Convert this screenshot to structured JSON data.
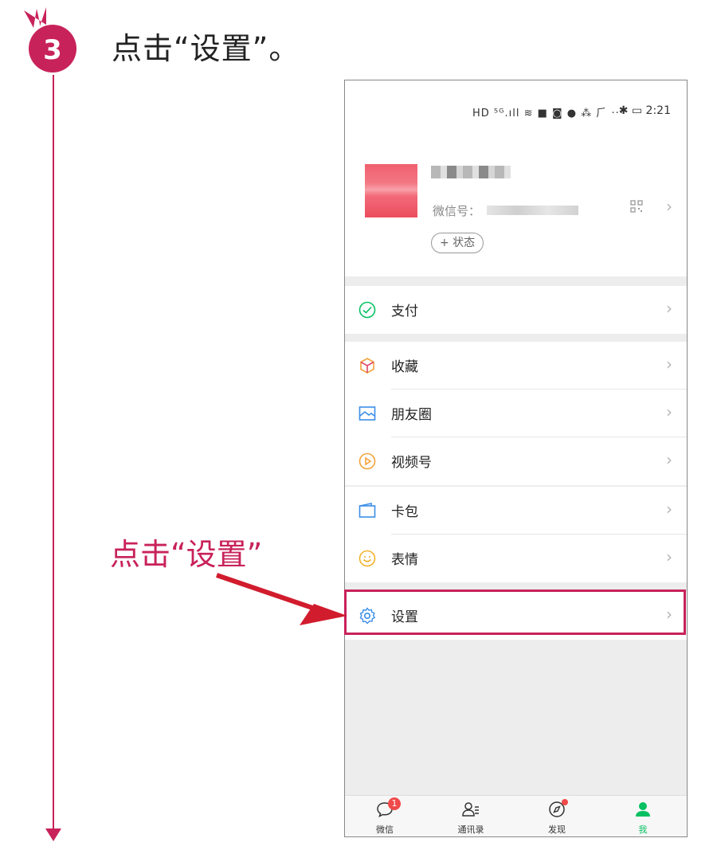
{
  "step": {
    "number": "3",
    "title": "点击“设置”。"
  },
  "callout": "点击“设置”",
  "colors": {
    "accent": "#c8225a",
    "wechat_green": "#07c160"
  },
  "status_bar": {
    "icons": "HD ⁵ᴳ.ıll ≋ ■ ◙ ● ⁂ ⺁ ···",
    "right": "✱ ▭ 2:21"
  },
  "profile": {
    "wxid_label": "微信号：",
    "status_button": "+ 状态"
  },
  "menu": [
    {
      "id": "pay",
      "label": "支付",
      "icon": "pay-check-icon"
    },
    {
      "id": "favorites",
      "label": "收藏",
      "icon": "cube-icon"
    },
    {
      "id": "moments",
      "label": "朋友圈",
      "icon": "image-icon"
    },
    {
      "id": "channels",
      "label": "视频号",
      "icon": "play-circle-icon"
    },
    {
      "id": "cards",
      "label": "卡包",
      "icon": "wallet-icon"
    },
    {
      "id": "stickers",
      "label": "表情",
      "icon": "smiley-icon"
    },
    {
      "id": "settings",
      "label": "设置",
      "icon": "gear-icon"
    }
  ],
  "tabbar": [
    {
      "label": "微信",
      "badge": "1"
    },
    {
      "label": "通讯录"
    },
    {
      "label": "发现"
    },
    {
      "label": "我"
    }
  ]
}
